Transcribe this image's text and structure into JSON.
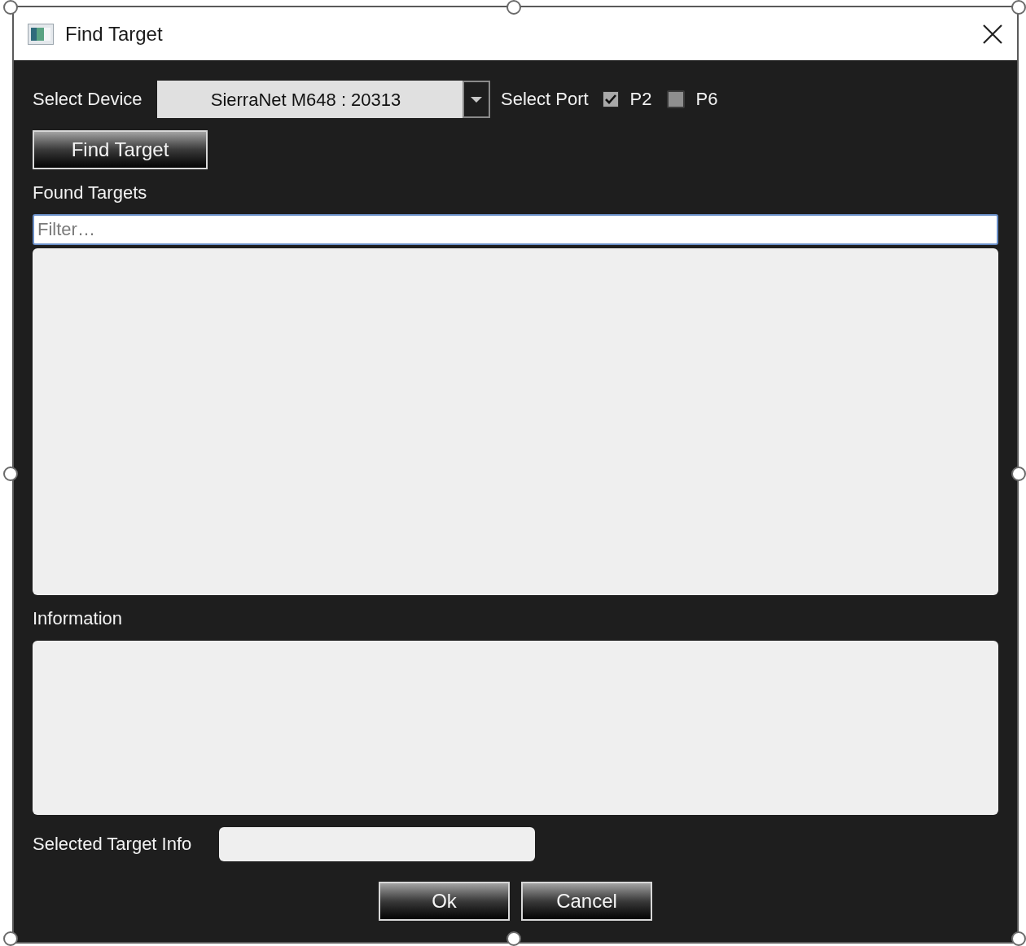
{
  "window": {
    "title": "Find Target"
  },
  "device": {
    "label": "Select Device",
    "value": "SierraNet M648 : 20313"
  },
  "port": {
    "label": "Select Port",
    "options": [
      {
        "label": "P2",
        "checked": true
      },
      {
        "label": "P6",
        "checked": false
      }
    ]
  },
  "find_button": "Find Target",
  "found_targets": {
    "label": "Found Targets",
    "filter": {
      "placeholder": "Filter…"
    }
  },
  "information": {
    "label": "Information"
  },
  "selected_target_info": {
    "label": "Selected Target Info"
  },
  "buttons": [
    "Ok",
    "Cancel"
  ]
}
